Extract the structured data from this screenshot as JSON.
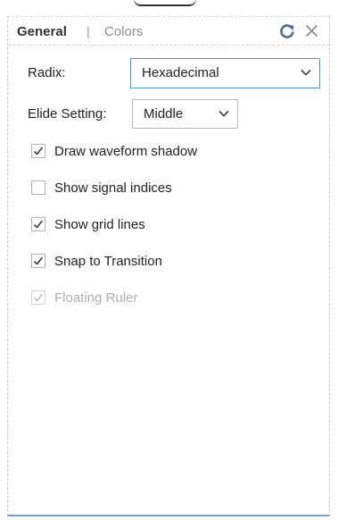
{
  "tabs": {
    "general": "General",
    "separator": "|",
    "colors": "Colors"
  },
  "header_icons": {
    "refresh": "refresh-icon",
    "close": "close-icon"
  },
  "radix": {
    "label": "Radix:",
    "value": "Hexadecimal"
  },
  "elide": {
    "label": "Elide Setting:",
    "value": "Middle"
  },
  "checkboxes": [
    {
      "label": "Draw waveform shadow",
      "checked": true,
      "enabled": true
    },
    {
      "label": "Show signal indices",
      "checked": false,
      "enabled": true
    },
    {
      "label": "Show grid lines",
      "checked": true,
      "enabled": true
    },
    {
      "label": "Snap to Transition",
      "checked": true,
      "enabled": true
    },
    {
      "label": "Floating Ruler",
      "checked": true,
      "enabled": false
    }
  ],
  "colors": {
    "accent": "#5b8fd6",
    "bottom_border": "#7a9cc4",
    "check": "#333333",
    "check_disabled": "#bdbdbd"
  }
}
